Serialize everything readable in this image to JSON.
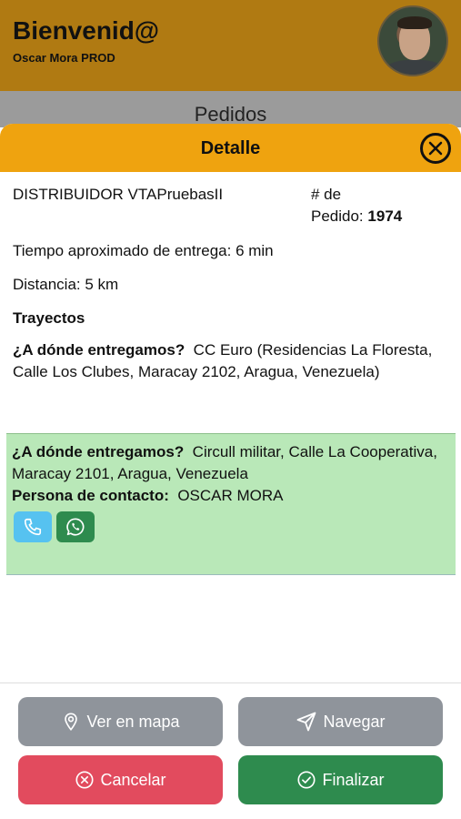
{
  "header": {
    "title": "Bienvenid@",
    "subtitle": "Oscar Mora PROD"
  },
  "background_title": "Pedidos",
  "detail": {
    "title": "Detalle",
    "distributor": "DISTRIBUIDOR VTAPruebasII",
    "order_label_1": "# de",
    "order_label_2": "Pedido:",
    "order_number": "1974",
    "eta": "Tiempo aproximado de entrega: 6 min",
    "distance": "Distancia: 5 km",
    "routes_title": "Trayectos",
    "stop1": {
      "question": "¿A dónde entregamos?",
      "address": "CC Euro (Residencias La Floresta, Calle Los Clubes, Maracay 2102, Aragua, Venezuela)"
    },
    "stop2": {
      "question": "¿A dónde entregamos?",
      "address": "Circull militar, Calle La Cooperativa, Maracay 2101, Aragua, Venezuela",
      "contact_label": "Persona de contacto:",
      "contact_name": "OSCAR MORA"
    }
  },
  "buttons": {
    "map": "Ver en mapa",
    "navigate": "Navegar",
    "cancel": "Cancelar",
    "finish": "Finalizar"
  },
  "colors": {
    "header_bg": "#b07a12",
    "sheet_header_bg": "#efa30f",
    "stop_highlight": "#b9e8b8",
    "phone_button": "#56c2f0",
    "whatsapp_button": "#2e8b4e",
    "neutral_button": "#8f949b",
    "cancel_button": "#e24b5e",
    "finish_button": "#2e8b4e"
  },
  "icons": [
    "close-icon",
    "phone-icon",
    "whatsapp-icon",
    "map-pin-icon",
    "send-icon",
    "cancel-circle-icon",
    "check-circle-icon"
  ]
}
